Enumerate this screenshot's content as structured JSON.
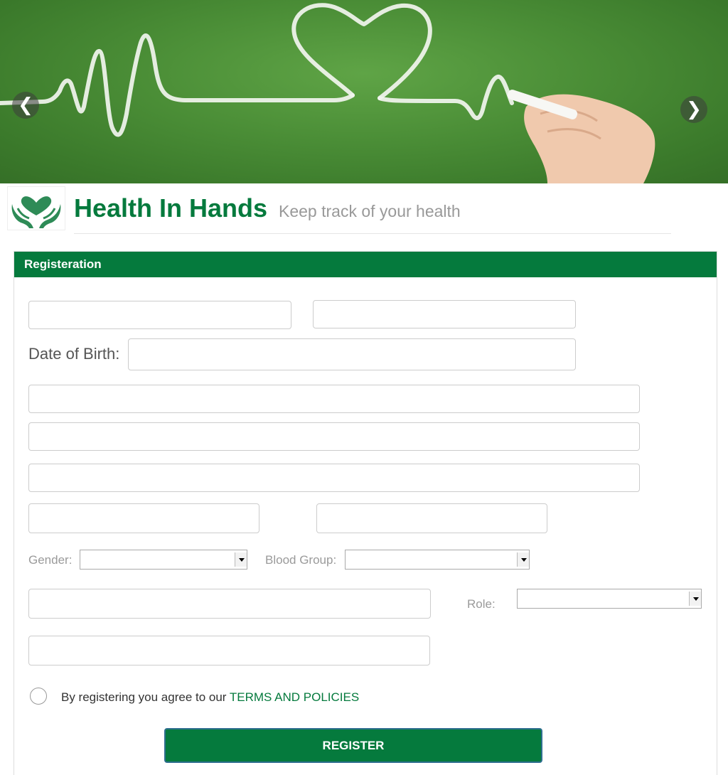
{
  "banner": {
    "prev_glyph": "❮",
    "next_glyph": "❯"
  },
  "brand": {
    "title": "Health In Hands",
    "tagline": "Keep track of your health",
    "logo_icon": "heart-in-hands-icon"
  },
  "form": {
    "header": "Registeration",
    "dob_label": "Date of Birth:",
    "gender_label": "Gender:",
    "gender_value": "",
    "blood_group_label": "Blood Group:",
    "blood_group_value": "",
    "role_label": "Role:",
    "role_value": "",
    "agree_text": "By registering you agree to our ",
    "terms_link": "TERMS AND POLICIES",
    "register_label": "REGISTER"
  },
  "colors": {
    "brand_green": "#057a3d",
    "muted_label": "#9a9a9a",
    "tagline_gray": "#999999"
  }
}
